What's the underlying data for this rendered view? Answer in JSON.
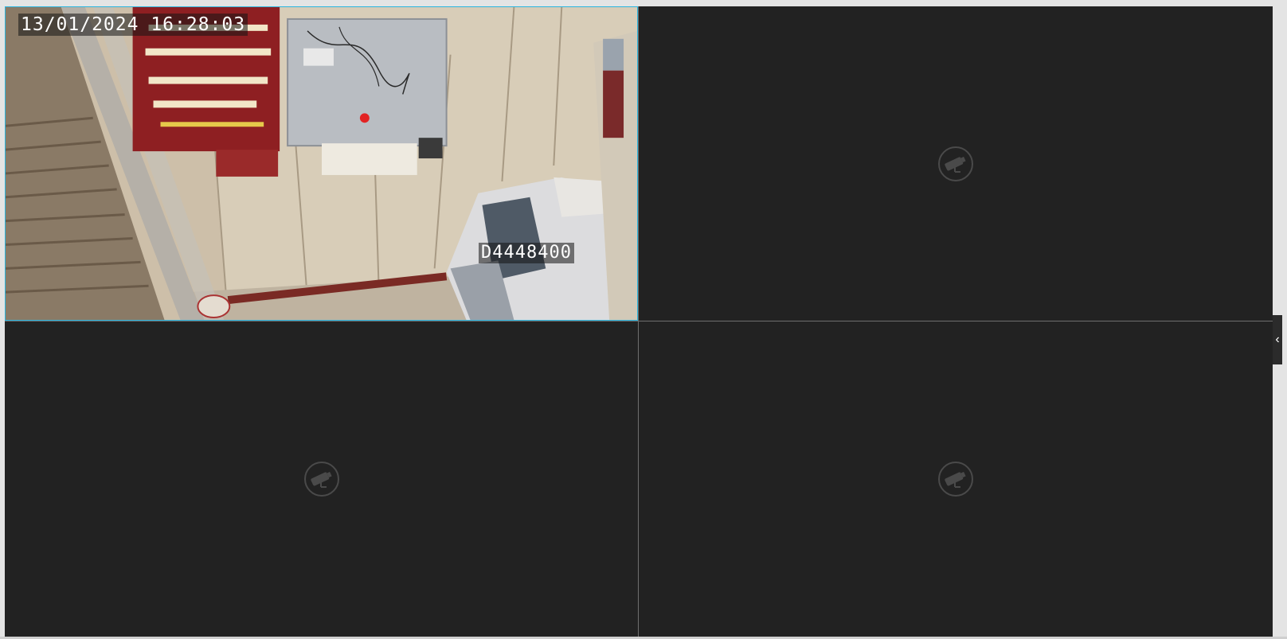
{
  "viewer": {
    "layout": "2x2",
    "selected_tile": 1
  },
  "tiles": [
    {
      "index": 1,
      "state": "live",
      "timestamp": "13/01/2024 16:28:03",
      "camera_label": "D4448400"
    },
    {
      "index": 2,
      "state": "empty",
      "icon": "cctv-camera-icon"
    },
    {
      "index": 3,
      "state": "empty",
      "icon": "cctv-camera-icon"
    },
    {
      "index": 4,
      "state": "empty",
      "icon": "cctv-camera-icon"
    }
  ],
  "side_panel": {
    "toggle_glyph": "‹",
    "icon": "chevron-left-icon"
  },
  "colors": {
    "selected_border": "#2ab5df",
    "tile_background": "#222222",
    "empty_icon": "#4a4a4a"
  }
}
